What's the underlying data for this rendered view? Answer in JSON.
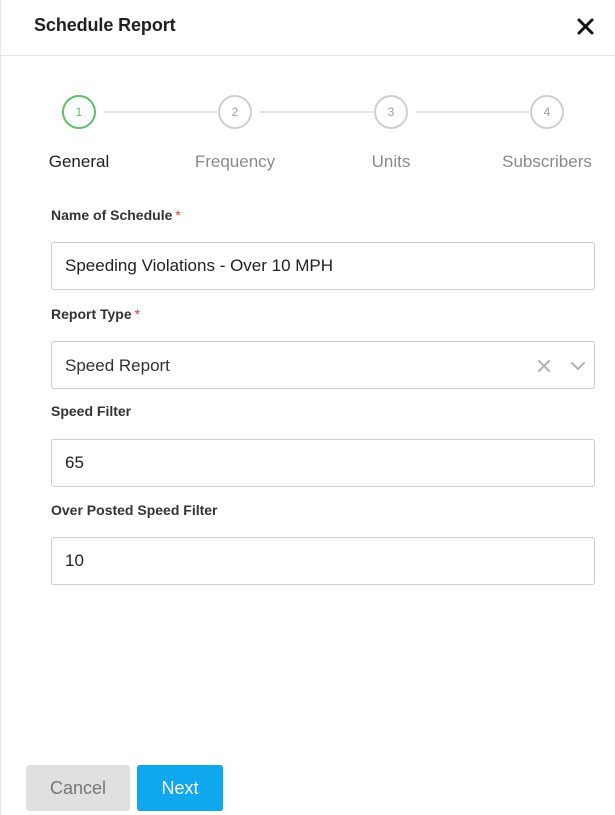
{
  "dialog": {
    "title": "Schedule Report",
    "close_icon": "close-icon"
  },
  "stepper": {
    "active_step": 1,
    "accent_color": "#5cbf6b",
    "steps": [
      {
        "number": "1",
        "label": "General"
      },
      {
        "number": "2",
        "label": "Frequency"
      },
      {
        "number": "3",
        "label": "Units"
      },
      {
        "number": "4",
        "label": "Subscribers"
      }
    ]
  },
  "form": {
    "name_of_schedule": {
      "label": "Name of Schedule",
      "required_marker": "*",
      "value": "Speeding Violations - Over 10 MPH"
    },
    "report_type": {
      "label": "Report Type",
      "required_marker": "*",
      "selected": "Speed Report",
      "clear_icon": "clear-icon",
      "dropdown_icon": "chevron-down-icon"
    },
    "speed_filter": {
      "label": "Speed Filter",
      "value": "65"
    },
    "over_posted_speed_filter": {
      "label": "Over Posted Speed Filter",
      "value": "10"
    }
  },
  "footer": {
    "cancel_label": "Cancel",
    "next_label": "Next",
    "next_color": "#0fa8ef"
  }
}
